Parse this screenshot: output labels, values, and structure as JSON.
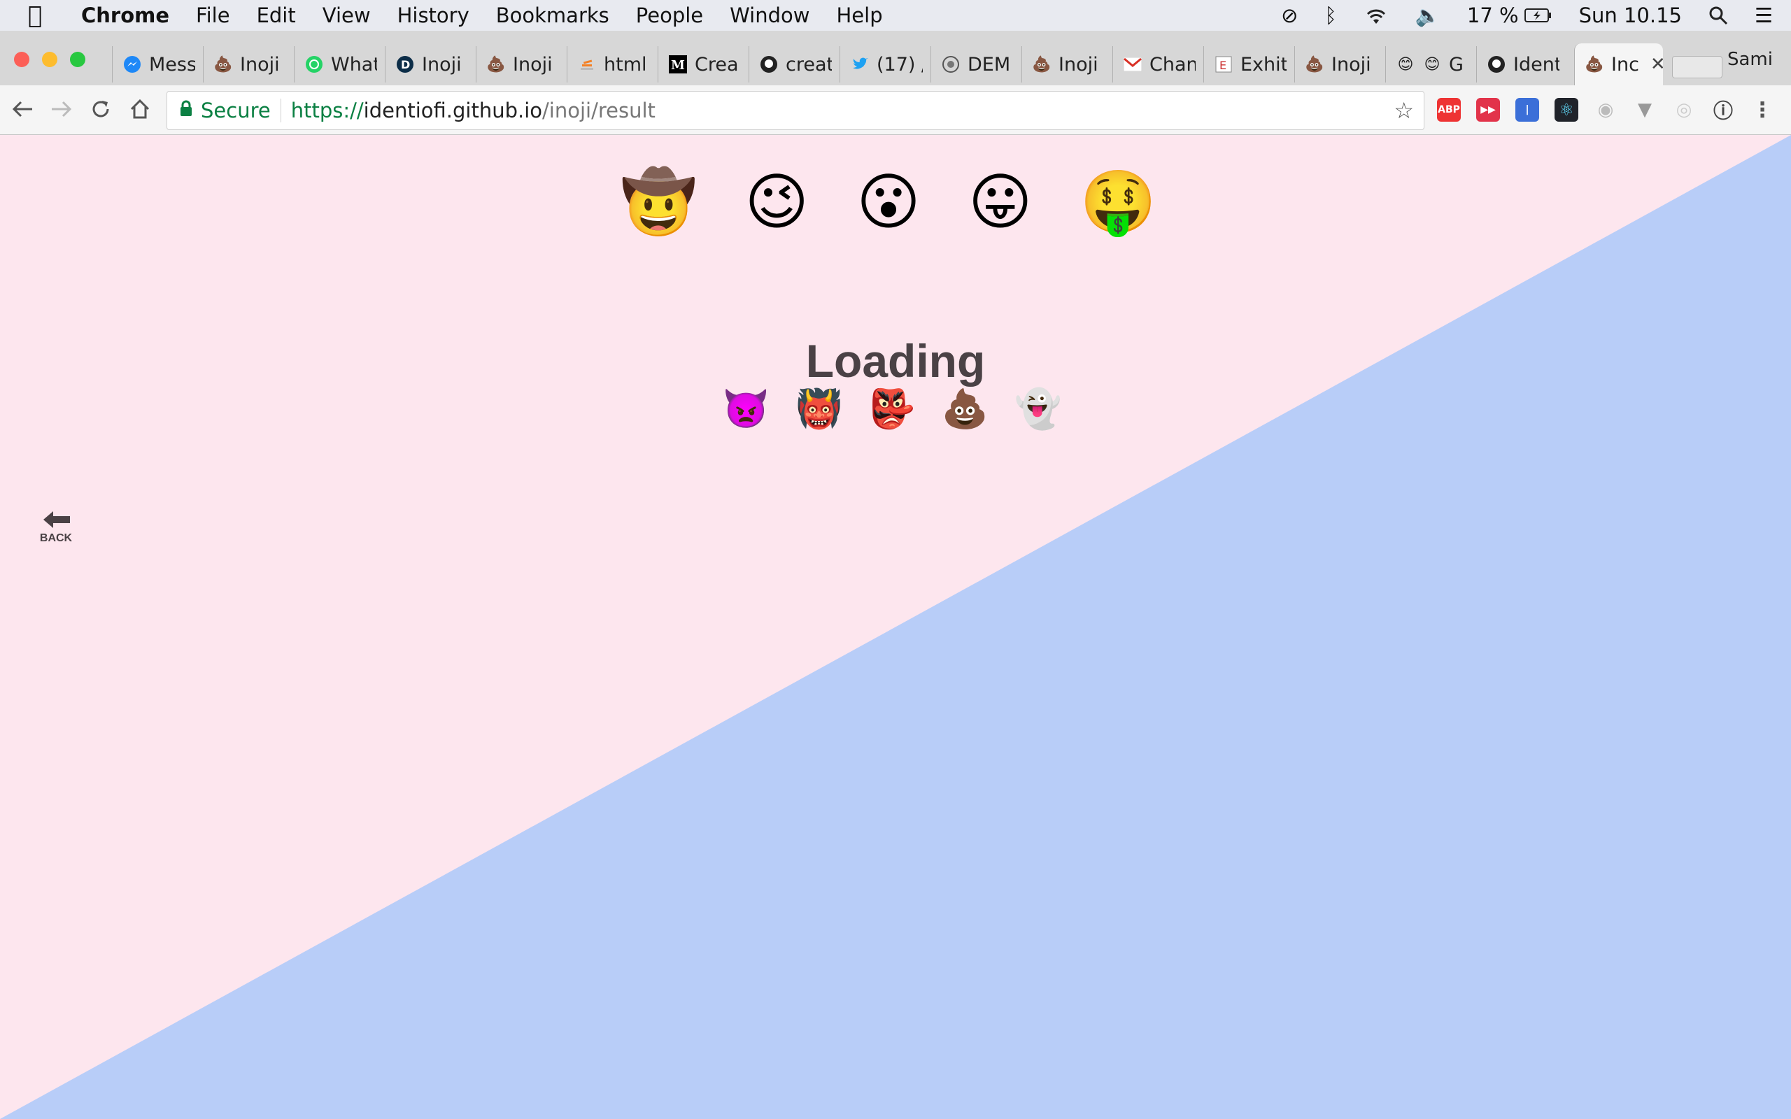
{
  "menubar": {
    "apple": "",
    "items": [
      "Chrome",
      "File",
      "Edit",
      "View",
      "History",
      "Bookmarks",
      "People",
      "Window",
      "Help"
    ],
    "battery": "17 %",
    "clock": "Sun 10.15"
  },
  "tabs": [
    {
      "title": "Mess",
      "favicon": "messenger-icon"
    },
    {
      "title": "Inoji",
      "favicon": "poop-icon"
    },
    {
      "title": "What",
      "favicon": "whatsapp-icon"
    },
    {
      "title": "Inoji",
      "favicon": "d-icon"
    },
    {
      "title": "Inoji",
      "favicon": "poop-icon"
    },
    {
      "title": "html",
      "favicon": "stackoverflow-icon"
    },
    {
      "title": "Crea",
      "favicon": "medium-icon"
    },
    {
      "title": "creat",
      "favicon": "github-icon"
    },
    {
      "title": "(17) /",
      "favicon": "twitter-icon"
    },
    {
      "title": "DEM",
      "favicon": "gear-icon"
    },
    {
      "title": "Inoji",
      "favicon": "poop-icon"
    },
    {
      "title": "Chan",
      "favicon": "gmail-icon"
    },
    {
      "title": "Exhit",
      "favicon": "exhibit-icon"
    },
    {
      "title": "Inoji",
      "favicon": "poop-icon"
    },
    {
      "title": "G",
      "favicon": "smile-icon"
    },
    {
      "title": "Ident",
      "favicon": "github-icon"
    },
    {
      "title": "Inc",
      "favicon": "poop-icon",
      "active": true
    }
  ],
  "profile": "Sami",
  "omnibox": {
    "secure_label": "Secure",
    "scheme": "https://",
    "host": "identiofi.github.io",
    "path": "/inoji/result"
  },
  "colors": {
    "page_bg": "#fde6ee",
    "diagonal": "#b8cdf8",
    "text": "#4a4145"
  },
  "page": {
    "top_emojis": [
      "🤠",
      "😉",
      "😮",
      "😛",
      "🤑"
    ],
    "loading_text": "Loading",
    "loading_emojis": [
      "👿",
      "👹",
      "👺",
      "💩",
      "👻"
    ],
    "back_label": "BACK"
  }
}
